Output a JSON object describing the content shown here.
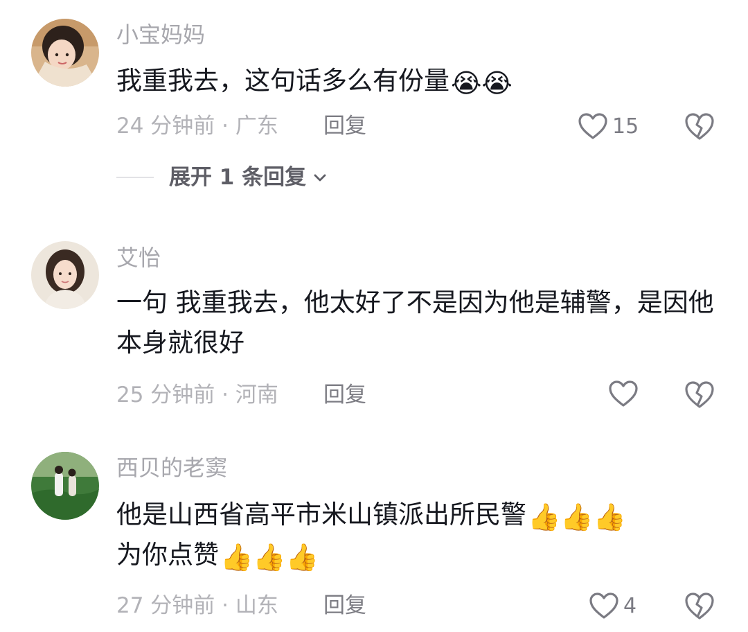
{
  "comments": [
    {
      "username": "小宝妈妈",
      "text": "我重我去，这句话多么有份量",
      "emoji_suffix": "😭😭",
      "time_location": "24 分钟前 · 广东",
      "reply_label": "回复",
      "like_count": "15",
      "expand_label": "展开 1 条回复"
    },
    {
      "username": "艾怡",
      "text": "一句 我重我去，他太好了不是因为他是辅警，是因他本身就很好",
      "emoji_suffix": "",
      "time_location": "25 分钟前 · 河南",
      "reply_label": "回复",
      "like_count": ""
    },
    {
      "username": "西贝的老窦",
      "text_line1": "他是山西省高平市米山镇派出所民警",
      "emoji_line1": "👍👍👍",
      "text_line2": "为你点赞",
      "emoji_line2": "👍👍👍",
      "time_location": "27 分钟前 · 山东",
      "reply_label": "回复",
      "like_count": "4"
    }
  ],
  "icons": {
    "like": "heart-outline-icon",
    "dislike": "broken-heart-icon",
    "expand": "chevron-down-icon"
  },
  "colors": {
    "text": "#16181f",
    "secondary": "#a7a7ad",
    "icon": "#7b7b83"
  }
}
